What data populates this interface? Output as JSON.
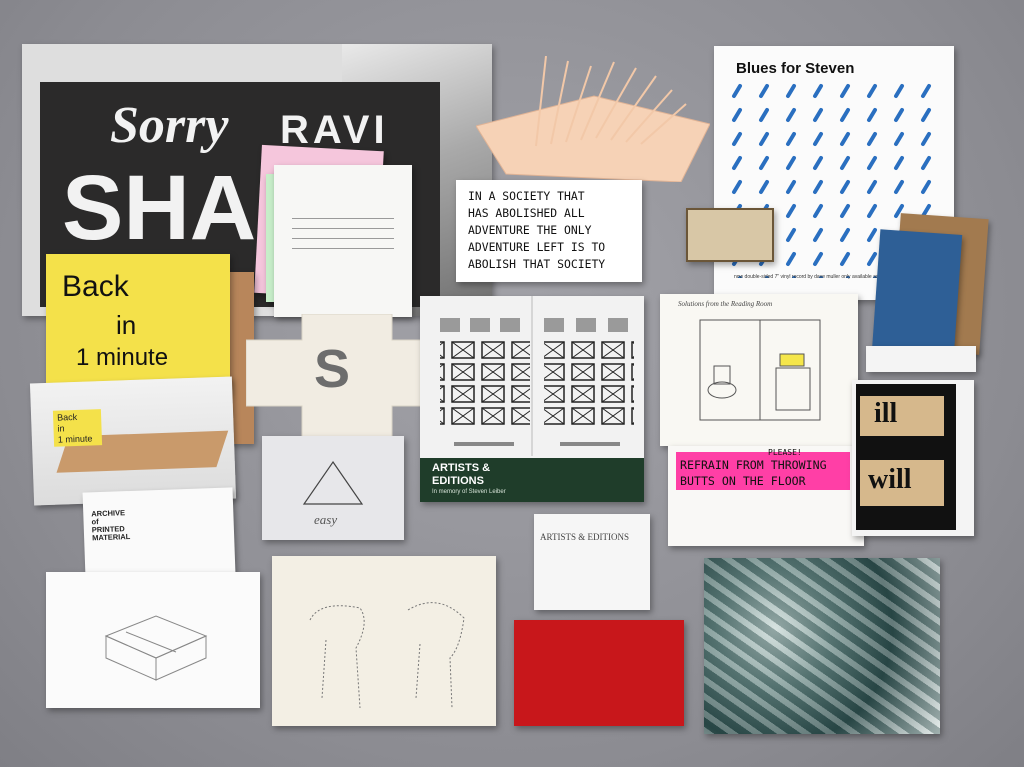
{
  "colors": {
    "backdrop": "#8f8f95",
    "poster_dark": "#2b2a2a",
    "yellow_sign": "#f4e14a",
    "pink_sign": "#ff3fa6",
    "red_book": "#c8171b",
    "blue_booklet": "#2e5f96",
    "box_green": "#1f3d2a"
  },
  "poster": {
    "word1": "Sorry",
    "word2": "RAVI",
    "word3": "SHAN"
  },
  "back_sign": {
    "line1": "Back",
    "line2": "in",
    "line3": "1 minute"
  },
  "photo_sign": {
    "line1": "Back",
    "line2": "in",
    "line3": "1 minute"
  },
  "society_card": {
    "line1": "IN A SOCIETY THAT",
    "line2": "HAS ABOLISHED ALL",
    "line3": "ADVENTURE THE ONLY",
    "line4": "ADVENTURE LEFT IS TO",
    "line5": "ABOLISH THAT SOCIETY"
  },
  "blues_poster": {
    "title": "Blues for Steven",
    "footer": "now double-sided 7\" vinyl record by dave muller only available as part of Artists and Editions"
  },
  "box": {
    "title1": "ARTISTS &",
    "title2": "EDITIONS",
    "subtitle": "In memory of Steven Leiber"
  },
  "booklet": {
    "title": "ARTISTS & EDITIONS"
  },
  "archive": {
    "line1": "ARCHIVE",
    "line2": "of",
    "line3": "PRINTED",
    "line4": "MATERIAL"
  },
  "easy_card": {
    "word": "easy"
  },
  "s_card": {
    "letter": "S"
  },
  "bathroom_drawing": {
    "caption": "Solutions from the Reading Room"
  },
  "floor_sign": {
    "line0": "PLEASE!",
    "line1": "REFRAIN FROM THROWING",
    "line2": "BUTTS ON THE FLOOR"
  },
  "ill_will": {
    "top": "ill",
    "bottom": "will"
  }
}
